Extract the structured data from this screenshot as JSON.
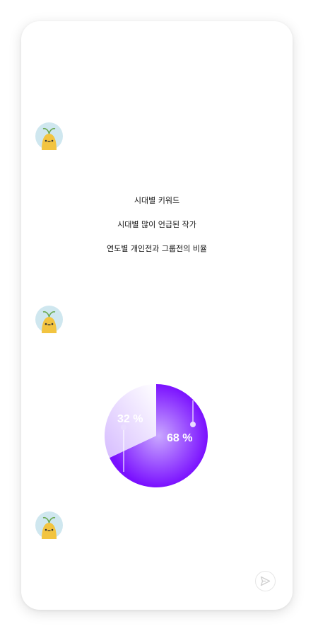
{
  "menu": {
    "items": [
      {
        "label": "시대별 키워드"
      },
      {
        "label": "시대별 많이 언급된 작가"
      },
      {
        "label": "연도별 개인전과 그룹전의 비율"
      }
    ]
  },
  "chart_data": {
    "type": "pie",
    "slices": [
      {
        "label": "68 %",
        "value": 68,
        "color": "#7a10ff"
      },
      {
        "label": "32 %",
        "value": 32,
        "color": "#e2cfff"
      }
    ]
  },
  "icons": {
    "avatar": "bean-character-icon",
    "send": "send-icon"
  }
}
